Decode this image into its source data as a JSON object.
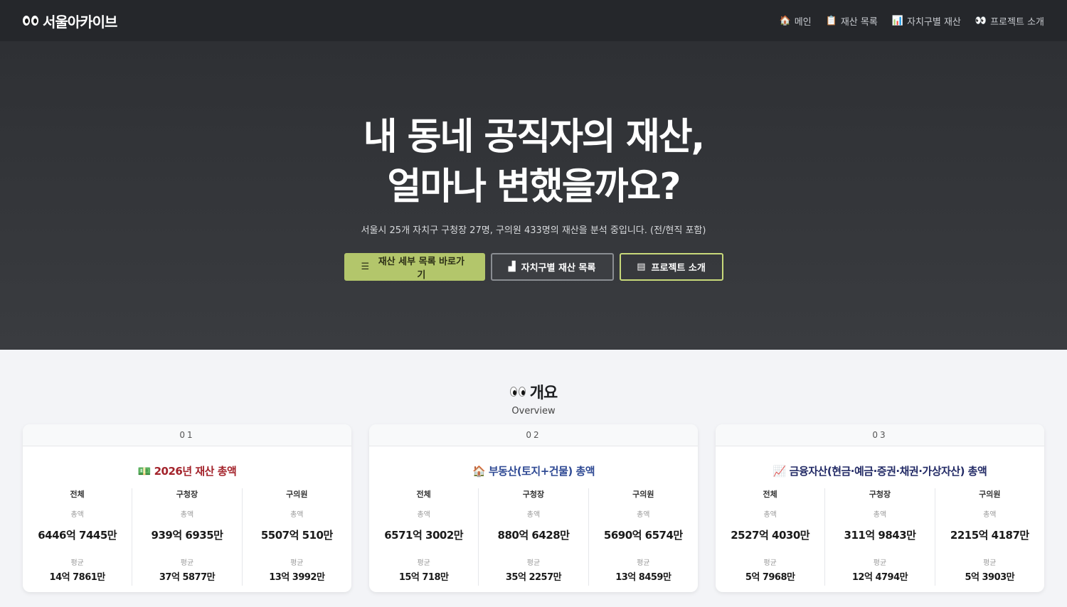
{
  "nav": {
    "brand": "서울아카이브",
    "links": [
      {
        "icon": "🏠",
        "label": "메인"
      },
      {
        "icon": "📋",
        "label": "재산 목록"
      },
      {
        "icon": "📊",
        "label": "자치구별 재산"
      },
      {
        "icon": "👀",
        "label": "프로젝트 소개"
      }
    ]
  },
  "hero": {
    "title_line1": "내 동네 공직자의 재산,",
    "title_line2": "얼마나 변했을까요?",
    "subtitle": "서울시 25개 자치구 구청장 27명, 구의원 433명의 재산을 분석 중입니다. (전/현직 포함)",
    "buttons": [
      {
        "icon": "☰",
        "label": "재산 세부 목록 바로가기"
      },
      {
        "icon": "▟",
        "label": "자치구별 재산 목록"
      },
      {
        "icon": "▤",
        "label": "프로젝트 소개"
      }
    ]
  },
  "overview": {
    "title": "개요",
    "subtitle": "Overview"
  },
  "cards": [
    {
      "num": "01",
      "icon": "💵",
      "title": "2026년 재산 총액",
      "stats": [
        {
          "head": "전체",
          "total_label": "총액",
          "total": "6446억 7445만",
          "avg_label": "평균",
          "avg": "14억 7861만"
        },
        {
          "head": "구청장",
          "total_label": "총액",
          "total": "939억 6935만",
          "avg_label": "평균",
          "avg": "37억 5877만"
        },
        {
          "head": "구의원",
          "total_label": "총액",
          "total": "5507억 510만",
          "avg_label": "평균",
          "avg": "13억 3992만"
        }
      ]
    },
    {
      "num": "02",
      "icon": "🏠",
      "title": "부동산(토지+건물) 총액",
      "stats": [
        {
          "head": "전체",
          "total_label": "총액",
          "total": "6571억 3002만",
          "avg_label": "평균",
          "avg": "15억 718만"
        },
        {
          "head": "구청장",
          "total_label": "총액",
          "total": "880억 6428만",
          "avg_label": "평균",
          "avg": "35억 2257만"
        },
        {
          "head": "구의원",
          "total_label": "총액",
          "total": "5690억 6574만",
          "avg_label": "평균",
          "avg": "13억 8459만"
        }
      ]
    },
    {
      "num": "03",
      "icon": "📈",
      "title": "금융자산(현금·예금·증권·채권·가상자산) 총액",
      "stats": [
        {
          "head": "전체",
          "total_label": "총액",
          "total": "2527억 4030만",
          "avg_label": "평균",
          "avg": "5억 7968만"
        },
        {
          "head": "구청장",
          "total_label": "총액",
          "total": "311억 9843만",
          "avg_label": "평균",
          "avg": "12억 4794만"
        },
        {
          "head": "구의원",
          "total_label": "총액",
          "total": "2215억 4187만",
          "avg_label": "평균",
          "avg": "5억 3903만"
        }
      ]
    }
  ]
}
